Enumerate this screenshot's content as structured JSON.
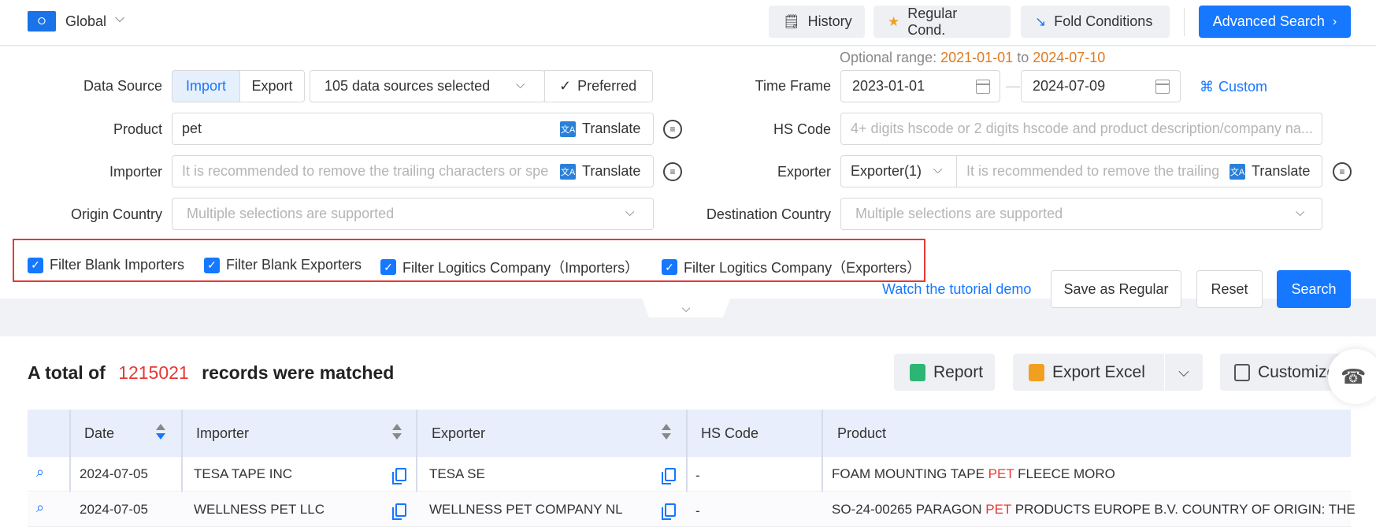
{
  "topbar": {
    "region_label": "Global",
    "history_label": "History",
    "regular_label": "Regular Cond.",
    "fold_label": "Fold Conditions",
    "advanced_label": "Advanced Search"
  },
  "form": {
    "data_source_label": "Data Source",
    "import_label": "Import",
    "export_label": "Export",
    "sources_value": "105 data sources selected",
    "preferred_label": "Preferred",
    "optional_prefix": "Optional range:",
    "optional_from": "2021-01-01",
    "optional_to_word": "to",
    "optional_to": "2024-07-10",
    "time_frame_label": "Time Frame",
    "date_start": "2023-01-01",
    "date_end": "2024-07-09",
    "custom_label": "Custom",
    "product_label": "Product",
    "product_value": "pet",
    "translate_label": "Translate",
    "hs_code_label": "HS Code",
    "hs_code_placeholder": "4+ digits hscode or 2 digits hscode and product description/company na...",
    "importer_label": "Importer",
    "importer_placeholder": "It is recommended to remove the trailing characters or spe",
    "exporter_label": "Exporter",
    "exporter_select": "Exporter(1)",
    "exporter_placeholder": "It is recommended to remove the trailing",
    "origin_label": "Origin Country",
    "origin_placeholder": "Multiple selections are supported",
    "destination_label": "Destination Country",
    "destination_placeholder": "Multiple selections are supported"
  },
  "filters": [
    {
      "label": "Filter Blank Importers",
      "checked": true
    },
    {
      "label": "Filter Blank Exporters",
      "checked": true
    },
    {
      "label": "Filter Logitics Company（Importers）",
      "checked": true
    },
    {
      "label": "Filter Logitics Company（Exporters）",
      "checked": true
    }
  ],
  "actions": {
    "tutorial_label": "Watch the tutorial demo",
    "save_regular_label": "Save as Regular",
    "reset_label": "Reset",
    "search_label": "Search"
  },
  "results": {
    "total_prefix": "A total of",
    "total_count": "1215021",
    "total_suffix": "records were matched",
    "report_label": "Report",
    "export_excel_label": "Export Excel",
    "customize_label": "Customize"
  },
  "table": {
    "headers": {
      "date": "Date",
      "importer": "Importer",
      "exporter": "Exporter",
      "hs_code": "HS Code",
      "product": "Product"
    },
    "rows": [
      {
        "date": "2024-07-05",
        "importer": "TESA TAPE INC",
        "exporter": "TESA SE",
        "hs_code": "-",
        "product_pre": "FOAM MOUNTING TAPE ",
        "product_hl": "PET",
        "product_post": " FLEECE MORO"
      },
      {
        "date": "2024-07-05",
        "importer": "WELLNESS PET LLC",
        "exporter": "WELLNESS PET COMPANY NL",
        "hs_code": "-",
        "product_pre": "SO-24-00265 PARAGON ",
        "product_hl": "PET",
        "product_post": " PRODUCTS EUROPE B.V. COUNTRY OF ORIGIN: THE"
      }
    ]
  },
  "colors": {
    "accent": "#1677ff",
    "highlight": "#e53935",
    "date_range": "#e07a1f"
  }
}
